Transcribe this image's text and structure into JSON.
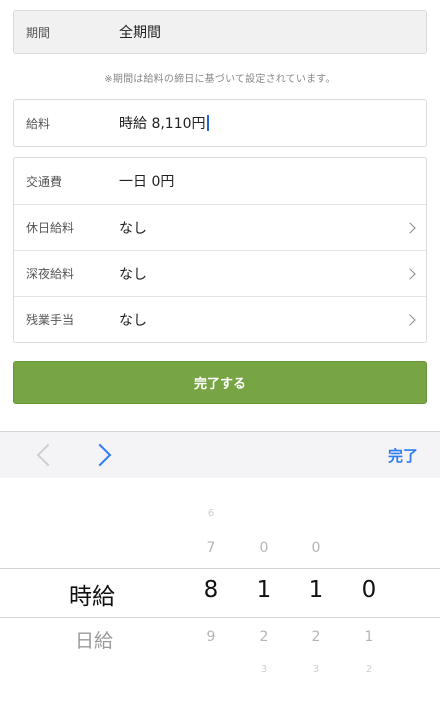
{
  "period": {
    "label": "期間",
    "value": "全期間"
  },
  "note": "※期間は給料の締日に基づいて設定されています。",
  "salary": {
    "label": "給料",
    "value": "時給 8,110円"
  },
  "details": [
    {
      "label": "交通費",
      "value": "一日 0円"
    },
    {
      "label": "休日給料",
      "value": "なし"
    },
    {
      "label": "深夜給料",
      "value": "なし"
    },
    {
      "label": "残業手当",
      "value": "なし"
    }
  ],
  "complete_button": "完了する",
  "toolbar": {
    "done": "完了"
  },
  "picker": {
    "type_column": {
      "selected": "時給",
      "below": "日給"
    },
    "digit_columns": [
      {
        "above2": "6",
        "above1": "7",
        "selected": "8",
        "below1": "9",
        "below2": ""
      },
      {
        "above2": "",
        "above1": "0",
        "selected": "1",
        "below1": "2",
        "below2": "3"
      },
      {
        "above2": "",
        "above1": "0",
        "selected": "1",
        "below1": "2",
        "below2": "3"
      },
      {
        "above2": "",
        "above1": "",
        "selected": "0",
        "below1": "1",
        "below2": "2"
      }
    ]
  }
}
